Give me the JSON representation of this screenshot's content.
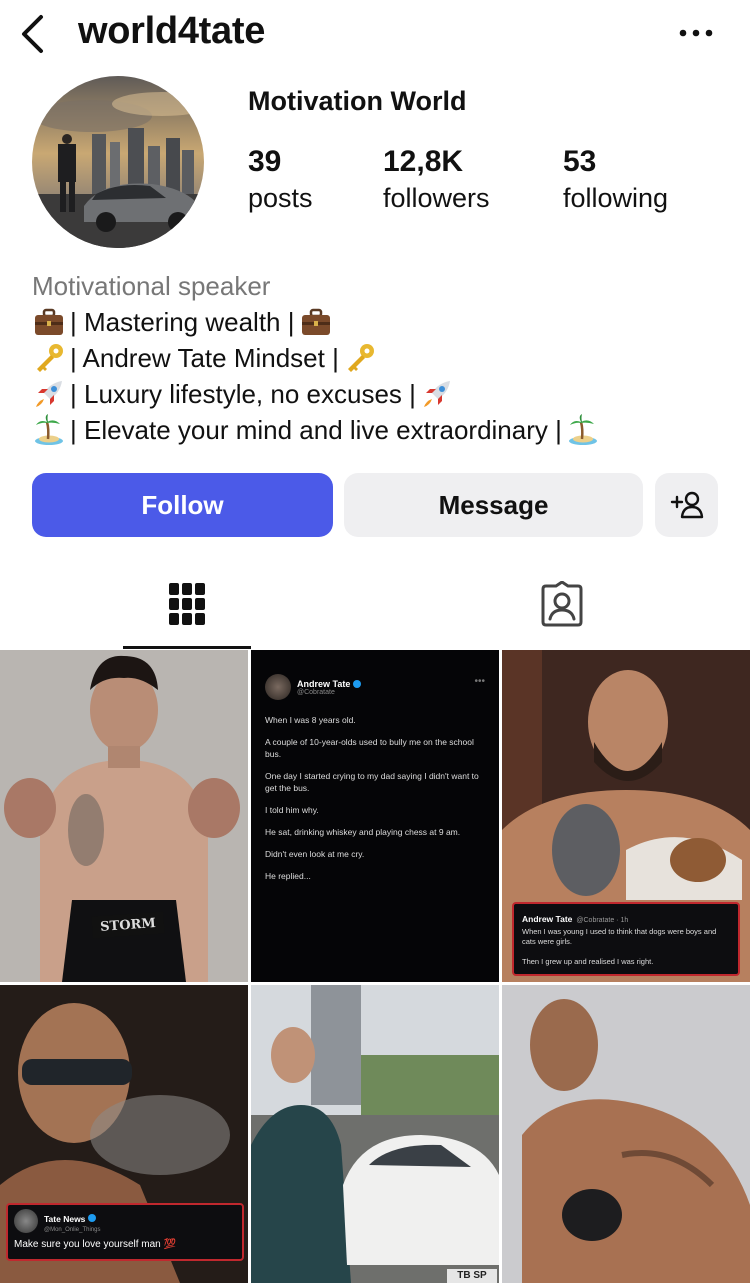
{
  "header": {
    "username": "world4tate",
    "back_icon": "chevron-left-icon",
    "more_icon": "more-horizontal-icon"
  },
  "profile": {
    "display_name": "Motivation World",
    "stats": [
      {
        "value": "39",
        "label": "posts"
      },
      {
        "value": "12,8K",
        "label": "followers"
      },
      {
        "value": "53",
        "label": "following"
      }
    ],
    "bio": {
      "category": "Motivational speaker",
      "lines": [
        {
          "icon": "briefcase-emoji",
          "text": "| Mastering wealth |"
        },
        {
          "icon": "key-emoji",
          "text": "| Andrew Tate Mindset |"
        },
        {
          "icon": "rocket-emoji",
          "text": "| Luxury lifestyle, no excuses |"
        },
        {
          "icon": "island-emoji",
          "text": "| Elevate your mind and live extraordinary |"
        }
      ]
    }
  },
  "actions": {
    "follow_label": "Follow",
    "message_label": "Message",
    "add_person_icon": "add-person-icon"
  },
  "tabs": [
    {
      "name": "posts-grid",
      "icon": "grid-icon",
      "active": true
    },
    {
      "name": "tagged",
      "icon": "tagged-person-icon",
      "active": false
    }
  ],
  "colors": {
    "follow_button": "#4b5ae8",
    "secondary_button": "#efeff1",
    "category_text": "#777777",
    "card_border": "#c0282e"
  },
  "posts": {
    "p1": {
      "shorts_text": "STORM"
    },
    "p2": {
      "name": "Andrew Tate",
      "handle": "@Cobratate",
      "body": [
        "When I was 8 years old.",
        "A couple of 10-year-olds used to bully me on the school bus.",
        "One day I started crying to my dad saying I didn't want to get the bus.",
        "I told him why.",
        "He sat, drinking whiskey and playing chess at 9 am.",
        "Didn't even look at me cry.",
        "He replied..."
      ]
    },
    "p3": {
      "name": "Andrew Tate",
      "meta": "@Cobratate · 1h",
      "line1": "When I was young I used to think that dogs were boys and cats were girls.",
      "line2": "Then I grew up and realised I was right."
    },
    "p4": {
      "name": "Tate News",
      "handle": "@Mon_Onlie_Things",
      "message": "Make sure you love yourself man",
      "heart": "💯"
    },
    "p5": {
      "plate_text": "TB SP"
    },
    "p6": {}
  }
}
